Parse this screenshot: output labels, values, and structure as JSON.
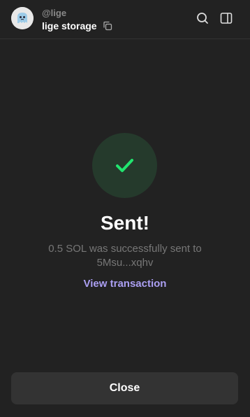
{
  "header": {
    "username": "@lige",
    "wallet_name": "lige storage",
    "icons": {
      "avatar": "ghost-avatar",
      "copy": "copy-icon",
      "search": "search-icon",
      "panel": "side-panel-icon"
    }
  },
  "status": {
    "icon": "checkmark-icon",
    "title": "Sent!",
    "message_line1": "0.5 SOL was successfully sent to",
    "message_line2": "5Msu...xqhv",
    "link_label": "View transaction"
  },
  "footer": {
    "close_label": "Close"
  },
  "colors": {
    "background": "#222222",
    "success_bg": "#253a2c",
    "success": "#21e56f",
    "accent": "#ab9ff2",
    "button_bg": "#333333"
  }
}
